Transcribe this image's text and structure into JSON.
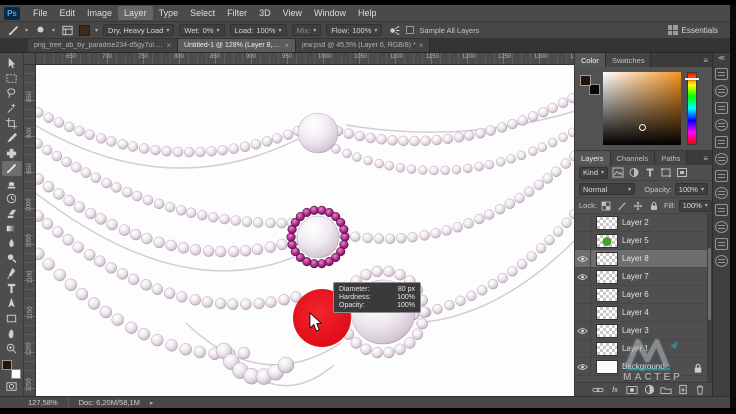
{
  "ui": {
    "dropdown": "▾",
    "close": "×",
    "menu": "≡",
    "collapse": "≪",
    "status_arrow": "▸"
  },
  "window": {
    "logo": "Ps"
  },
  "menu": {
    "items": [
      {
        "label": "File"
      },
      {
        "label": "Edit"
      },
      {
        "label": "Image"
      },
      {
        "label": "Layer",
        "active": true
      },
      {
        "label": "Type"
      },
      {
        "label": "Select"
      },
      {
        "label": "Filter"
      },
      {
        "label": "3D"
      },
      {
        "label": "View"
      },
      {
        "label": "Window"
      },
      {
        "label": "Help"
      }
    ]
  },
  "options": {
    "preset_label": "Dry, Heavy Load",
    "wet_label": "Wet:",
    "wet_value": "0%",
    "load_label": "Load:",
    "load_value": "100%",
    "mix_label": "Mix:",
    "flow_label": "Flow:",
    "flow_value": "100%",
    "sample_all_layers_label": "Sample All Layers",
    "workspace_label": "Essentials"
  },
  "tabs": [
    {
      "title": "png_tree_ab_by_paradise234-d5gy7ul.png @ 16,7% (Layer 0, RGB/8) *"
    },
    {
      "title": "Untitled-1 @ 128% (Layer 8, RGB/8) *",
      "active": true
    },
    {
      "title": "jew.psd @ 45,5% (Layer 6, RGB/8) *"
    }
  ],
  "rulers": {
    "horizontal": [
      "650",
      "700",
      "750",
      "800",
      "850",
      "900",
      "950",
      "1000",
      "1050",
      "1100",
      "1150",
      "1200",
      "1250",
      "1300",
      "1350"
    ],
    "vertical": [
      "850",
      "900",
      "950",
      "1000",
      "1050",
      "1100",
      "1150",
      "1200",
      "1250"
    ]
  },
  "brush_tooltip": {
    "diameter_label": "Diameter:",
    "diameter_value": "80 px",
    "hardness_label": "Hardness:",
    "hardness_value": "100%",
    "opacity_label": "Opacity:",
    "opacity_value": "100%"
  },
  "color_panel": {
    "tabs": [
      {
        "label": "Color",
        "active": true
      },
      {
        "label": "Swatches"
      }
    ]
  },
  "layers_panel": {
    "tabs": [
      {
        "label": "Layers",
        "active": true
      },
      {
        "label": "Channels"
      },
      {
        "label": "Paths"
      }
    ],
    "kind_label": "Kind",
    "blend_mode": "Normal",
    "opacity_label": "Opacity:",
    "opacity_value": "100%",
    "lock_label": "Lock:",
    "fill_label": "Fill:",
    "fill_value": "100%",
    "fx_label": "fx",
    "layers": [
      {
        "name": "Layer 2",
        "thumb": "checker"
      },
      {
        "name": "Layer 5",
        "thumb": "green"
      },
      {
        "name": "Layer 8",
        "thumb": "checker",
        "visible": true,
        "selected": true
      },
      {
        "name": "Layer 7",
        "thumb": "checker",
        "visible": true
      },
      {
        "name": "Layer 6",
        "thumb": "checker"
      },
      {
        "name": "Layer 4",
        "thumb": "checker"
      },
      {
        "name": "Layer 3",
        "thumb": "checker",
        "visible": true
      },
      {
        "name": "Layer 1",
        "thumb": "checker"
      },
      {
        "name": "Background",
        "thumb": "white",
        "visible": true,
        "locked": true
      }
    ]
  },
  "status_bar": {
    "zoom": "127,58%",
    "doc": "Doc: 6,20M/58,1M"
  },
  "watermark": {
    "text": "МАСТЕР"
  },
  "colors": {
    "accent_red": "#e8101b",
    "hue_orange": "#f7941e",
    "foreground_swatch": "#241309",
    "purple_bead": "#a1227d"
  },
  "icons": {
    "toolbar_tools": [
      "move",
      "rectangular-marquee",
      "lasso",
      "quick-selection",
      "crop",
      "eyedropper",
      "healing-brush",
      "brush",
      "clone-stamp",
      "history-brush",
      "eraser",
      "gradient",
      "blur",
      "dodge",
      "pen",
      "type",
      "path-selection",
      "rectangle",
      "hand",
      "zoom"
    ],
    "active_tool": "brush"
  }
}
